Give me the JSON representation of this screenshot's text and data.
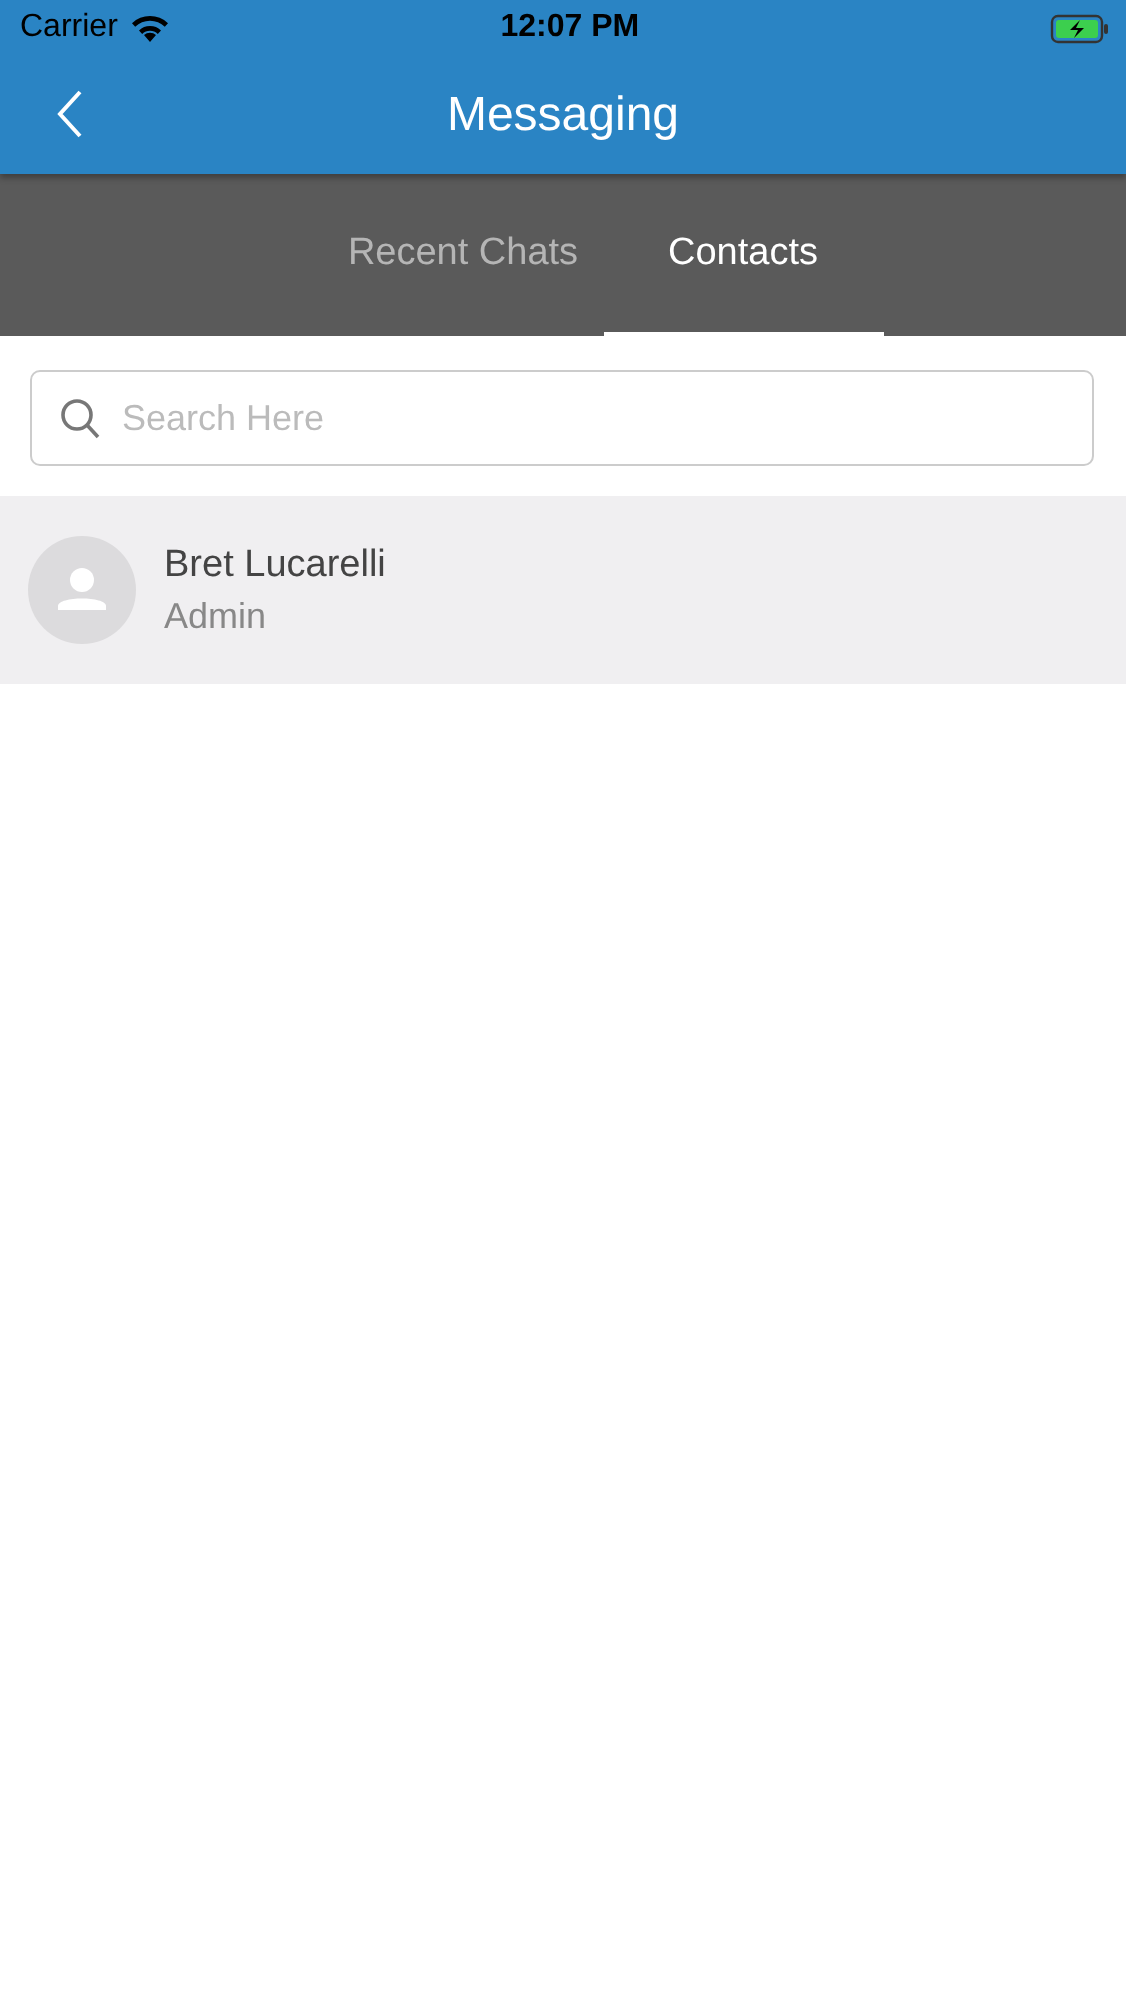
{
  "status_bar": {
    "carrier": "Carrier",
    "time": "12:07 PM",
    "charging": true
  },
  "header": {
    "title": "Messaging"
  },
  "tabs": [
    {
      "label": "Recent Chats",
      "selected": false
    },
    {
      "label": "Contacts",
      "selected": true
    }
  ],
  "search": {
    "placeholder": "Search Here"
  },
  "contacts": [
    {
      "name": "Bret Lucarelli",
      "role": "Admin",
      "selected": true
    }
  ]
}
